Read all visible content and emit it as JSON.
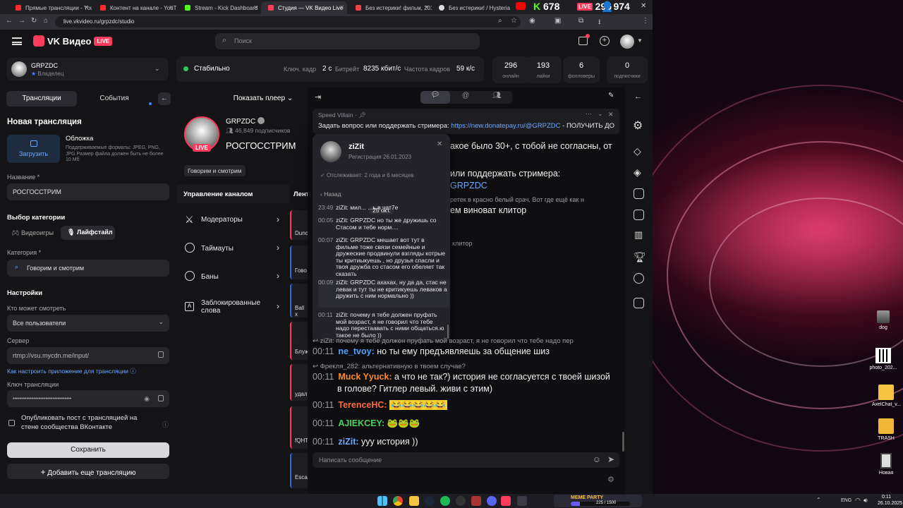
{
  "browser": {
    "tabs": [
      {
        "label": "Прямые трансляции - YouTube",
        "color": "#ff2a2a"
      },
      {
        "label": "Контент на канале - YouTube St",
        "color": "#ff2a2a"
      },
      {
        "label": "Stream - Kick Dashboard",
        "color": "#53fc18"
      },
      {
        "label": "Студия — VK Видео Live",
        "color": "#ff3b5c",
        "active": true
      },
      {
        "label": "Без истерики! фильм, 2010, до",
        "color": "#e44"
      },
      {
        "label": "Без истерики! / Hysteria",
        "color": "#ddd"
      }
    ],
    "url": "live.vkvideo.ru/grpzdc/studio",
    "tab_counters": {
      "kick": "678",
      "vk": "296",
      "viewers": "974"
    }
  },
  "header": {
    "logo": "VK Видео",
    "live_badge": "LIVE",
    "search_placeholder": "Поиск"
  },
  "account": {
    "name": "GRPZDC",
    "role": "Владелец"
  },
  "status_bar": {
    "status": "Стабильно",
    "keyframe_label": "Ключ. кадр",
    "keyframe_value": "2 с",
    "bitrate_label": "Битрейт",
    "bitrate_value": "8235 кбит/с",
    "fps_label": "Частота кадров",
    "fps_value": "59 к/с"
  },
  "stats": [
    {
      "value": "296",
      "label": "онлайн"
    },
    {
      "value": "193",
      "label": "лайки"
    },
    {
      "value": "6",
      "label": "фолловеры"
    },
    {
      "value": "0",
      "label": "подписчики"
    }
  ],
  "sidebar": {
    "tab_streams": "Трансляции",
    "tab_events": "События",
    "new_stream_title": "Новая трансляция",
    "cover_label": "Обложка",
    "upload_label": "Загрузить",
    "cover_hint": "Поддерживаемые форматы: JPEG, PNG, JPG Размер файла должен быть не более 10 Мб",
    "name_label": "Название *",
    "name_value": "РОСГОССТРИМ",
    "category_section": "Выбор категории",
    "cat_games": "Видеоигры",
    "cat_lifestyle": "Лайфстайл",
    "category_label": "Категория *",
    "category_value": "Говорим и смотрим",
    "settings_title": "Настройки",
    "who_can_watch_label": "Кто может смотреть",
    "who_can_watch_value": "Все пользователи",
    "server_label": "Сервер",
    "server_value": "rtmp://vsu.mycdn.me/input/",
    "howto_link": "Как настроить приложение для трансляции",
    "key_label": "Ключ трансляции",
    "key_value": "••••••••••••••••••••••••••••••••••",
    "publish_label": "Опубликовать пост с трансляцией на стене сообщества ВКонтакте",
    "save_button": "Сохранить",
    "add_button": "Добавить еще трансляцию"
  },
  "center": {
    "show_player": "Показать плеер",
    "channel_name": "GRPZDC",
    "subscribers": "46,849 подписчиков",
    "stream_title": "РОСГОССТРИМ",
    "live_badge": "LIVE",
    "category_chip": "Говорим и смотрим",
    "manage_title": "Управление каналом",
    "lent_title": "Лент",
    "menu": [
      {
        "label": "Модераторы"
      },
      {
        "label": "Таймауты"
      },
      {
        "label": "Баны"
      },
      {
        "label": "Заблокированные слова"
      }
    ],
    "queue_snippets": [
      "Dunc",
      "Гово",
      "Ball x",
      "Блуж",
      "удал",
      "fQHT",
      "Esca"
    ]
  },
  "chat": {
    "pinned_author": "Speed Villain",
    "pinned_text_prefix": "Задать вопрос или поддержать стримера: ",
    "pinned_link": "https://new.donatepay.ru/@GRPZDC",
    "pinned_text_suffix": " - ПОЛУЧИТЬ ДОСТУП ...",
    "bg_fragments": [
      "акое было 30+, с тобой не согласны, от",
      "или поддержать стримера:",
      "GRPZDC",
      "ретек в красно белый срач. Вот где ещё как н",
      "ем виноват клитор",
      "клитор"
    ],
    "messages": [
      {
        "time": "",
        "user": "",
        "user_color": "#9a9aa2",
        "text": "ziZit: почему я тебе должен пруфать мой возраст, я не говорил что тебе надо пер",
        "reply": true
      },
      {
        "time": "00:11",
        "user": "ne_tvoy:",
        "user_color": "#4ea0ff",
        "text": "но ты ему предъявляешь за общение шиз"
      },
      {
        "time": "",
        "user": "",
        "user_color": "#9a9aa2",
        "text": "Фрекля_282: альтернативную в твоем случае?",
        "reply": true
      },
      {
        "time": "00:11",
        "user": "Muck Yyuck:",
        "user_color": "#ff8a2a",
        "text": "а что не так?) история не согласуется с твоей шизой"
      },
      {
        "time": "",
        "user": "",
        "user_color": "#eee",
        "text": "в голове? Гитлер левый. живи с этим)",
        "cont": true
      },
      {
        "time": "00:11",
        "user": "TerenceHC:",
        "user_color": "#ff6a3d",
        "text": "😂😂😂😂😂"
      },
      {
        "time": "00:11",
        "user": "AJIEKCEY:",
        "user_color": "#4fd15a",
        "text": "🐸🐸🐸"
      },
      {
        "time": "00:11",
        "user": "ziZit:",
        "user_color": "#6fa8ff",
        "text": "ууу история ))"
      }
    ],
    "input_placeholder": "Написать сообщение"
  },
  "user_popup": {
    "name": "ziZit",
    "registered": "Регистрация 26.01.2023",
    "following": "Отслеживает: 2 года и 6 месяцев",
    "back": "Назад",
    "date_chip": "25 окт.",
    "history": [
      {
        "time": "23:49",
        "text": "ziZit: мил... ...ь в чат7е"
      },
      {
        "time": "00:05",
        "text": "ziZit: GRPZDC но ты же дружишь со Стасом и тебе норм...."
      },
      {
        "time": "00:07",
        "text": "ziZit: GRPZDC мешает вот тут в фильме тоже связи семейные и дружеские продвинули взгляды котрые ты критиыкуешь , но друзья спасли и твоя дружба со стасом его обеляет так сказать"
      },
      {
        "time": "00:09",
        "text": "ziZit: GRPZDC ахахах, ну да да, стас не левак и тут ты не критикуешь леваков а дружить с ним нормально ))"
      },
      {
        "time": "00:11",
        "text": "ziZit: почему я тебе должен пруфать мой возраст, я не говорил что тебе надо перестаавать с ними общаться.ю такое не было ))"
      }
    ]
  },
  "desktop": {
    "icons": [
      {
        "label": "dog"
      },
      {
        "label": "photo_202..."
      },
      {
        "label": "AxelChat_v..."
      },
      {
        "label": "TRASH"
      },
      {
        "label": "Новая"
      }
    ]
  },
  "taskbar": {
    "lang": "ENG",
    "time": "0:11",
    "date": "26.10.2025",
    "widget_title": "МЕМЕ PARTY",
    "widget_progress": "225 / 1500"
  }
}
